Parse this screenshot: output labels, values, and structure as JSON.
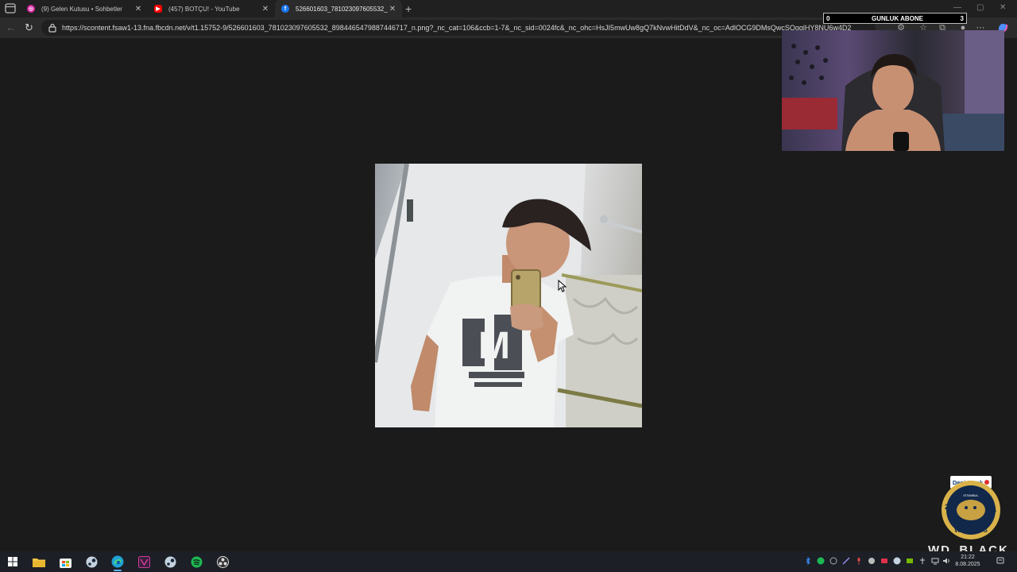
{
  "browser": {
    "tabs": [
      {
        "title": "(9) Gelen Kutusu • Sohbetler",
        "icon": "instagram-icon",
        "color": "#d6249f"
      },
      {
        "title": "(457) BOTÇU! - YouTube",
        "icon": "youtube-icon",
        "color": "#ff0000"
      },
      {
        "title": "526601603_781023097605532_8…",
        "icon": "facebook-icon",
        "color": "#1877f2",
        "active": true
      }
    ],
    "new_tab_label": "+",
    "url": "https://scontent.fsaw1-13.fna.fbcdn.net/v/t1.15752-9/526601603_781023097605532_8984465479887446717_n.png?_nc_cat=106&ccb=1-7&_nc_sid=0024fc&_nc_ohc=HsJI5mwUw8gQ7kNvwHitDdV&_nc_oc=AdlOCG9DMsQwcSOgglHY8NU6w4D2"
  },
  "content": {
    "image_subject": "mirror-selfie"
  },
  "stream_overlay": {
    "subscriber_counter": {
      "left": "0",
      "label": "GUNLUK ABONE",
      "right": "3"
    },
    "sponsor_badge": {
      "brand": "DenizBank",
      "team": "WILDCATS",
      "city": "ISTANBUL",
      "year_left": "20",
      "year_right": "06"
    },
    "brand_watermark": "WD_BLACK"
  },
  "taskbar": {
    "apps": [
      "windows-start-icon",
      "file-explorer-icon",
      "store-icon",
      "steam-icon",
      "edge-icon",
      "app-icon",
      "steam-icon",
      "spotify-icon",
      "obs-icon"
    ],
    "clock": {
      "time": "21:22",
      "date": "8.08.2025"
    }
  },
  "colors": {
    "accent": "#5ab0ff",
    "bg": "#1b1b1b"
  }
}
